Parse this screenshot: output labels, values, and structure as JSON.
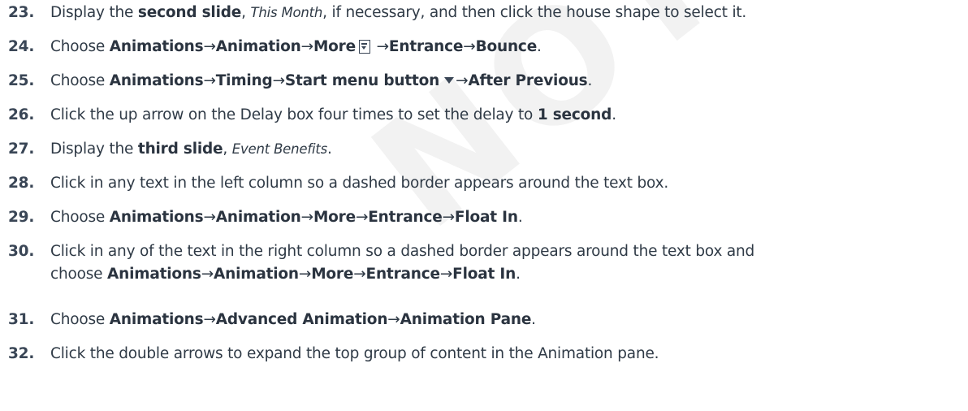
{
  "watermark": "NOT FOR SALE OR DISTRIBUTION ONLY",
  "steps": [
    {
      "num": "23.",
      "parts": [
        {
          "t": "Display the "
        },
        {
          "t": "second slide",
          "s": "b"
        },
        {
          "t": ", "
        },
        {
          "t": "This Month",
          "s": "i"
        },
        {
          "t": ", if necessary, and then click the house shape to select it."
        }
      ]
    },
    {
      "num": "24.",
      "parts": [
        {
          "t": "Choose "
        },
        {
          "t": "Animations",
          "s": "b"
        },
        {
          "t": "→",
          "s": "arr"
        },
        {
          "t": "Animation",
          "s": "b"
        },
        {
          "t": "→",
          "s": "arr"
        },
        {
          "t": "More",
          "s": "b"
        },
        {
          "icon": "more-dropdown-icon"
        },
        {
          "t": " →",
          "s": "arr"
        },
        {
          "t": "Entrance",
          "s": "b"
        },
        {
          "t": "→",
          "s": "arr"
        },
        {
          "t": "Bounce",
          "s": "b"
        },
        {
          "t": "."
        }
      ]
    },
    {
      "num": "25.",
      "parts": [
        {
          "t": "Choose "
        },
        {
          "t": "Animations",
          "s": "b"
        },
        {
          "t": "→",
          "s": "arr"
        },
        {
          "t": "Timing",
          "s": "b"
        },
        {
          "t": "→",
          "s": "arr"
        },
        {
          "t": "Start menu button",
          "s": "b"
        },
        {
          "icon": "dropdown-arrow-icon"
        },
        {
          "t": "→",
          "s": "arr"
        },
        {
          "t": "After Previous",
          "s": "b"
        },
        {
          "t": "."
        }
      ]
    },
    {
      "num": "26.",
      "parts": [
        {
          "t": "Click the up arrow on the Delay box four times to set the delay to "
        },
        {
          "t": "1 second",
          "s": "b"
        },
        {
          "t": "."
        }
      ]
    },
    {
      "num": "27.",
      "parts": [
        {
          "t": "Display the "
        },
        {
          "t": "third slide",
          "s": "b"
        },
        {
          "t": ", "
        },
        {
          "t": "Event Benefits",
          "s": "i"
        },
        {
          "t": "."
        }
      ]
    },
    {
      "num": "28.",
      "parts": [
        {
          "t": "Click in any text in the left column so a dashed border appears around the text box."
        }
      ]
    },
    {
      "num": "29.",
      "parts": [
        {
          "t": "Choose "
        },
        {
          "t": "Animations",
          "s": "b"
        },
        {
          "t": "→",
          "s": "arr"
        },
        {
          "t": "Animation",
          "s": "b"
        },
        {
          "t": "→",
          "s": "arr"
        },
        {
          "t": "More",
          "s": "b"
        },
        {
          "t": "→",
          "s": "arr"
        },
        {
          "t": "Entrance",
          "s": "b"
        },
        {
          "t": "→",
          "s": "arr"
        },
        {
          "t": "Float In",
          "s": "b"
        },
        {
          "t": "."
        }
      ]
    },
    {
      "num": "30.",
      "parts": [
        {
          "t": "Click in any of the text in the right column so a dashed border appears around the text box and"
        },
        {
          "br": true
        },
        {
          "t": "choose "
        },
        {
          "t": "Animations",
          "s": "b"
        },
        {
          "t": "→",
          "s": "arr"
        },
        {
          "t": "Animation",
          "s": "b"
        },
        {
          "t": "→",
          "s": "arr"
        },
        {
          "t": "More",
          "s": "b"
        },
        {
          "t": "→",
          "s": "arr"
        },
        {
          "t": "Entrance",
          "s": "b"
        },
        {
          "t": "→",
          "s": "arr"
        },
        {
          "t": "Float In",
          "s": "b"
        },
        {
          "t": "."
        }
      ]
    },
    {
      "num": "31.",
      "parts": [
        {
          "t": "Choose "
        },
        {
          "t": "Animations",
          "s": "b"
        },
        {
          "t": "→",
          "s": "arr"
        },
        {
          "t": "Advanced Animation",
          "s": "b"
        },
        {
          "t": "→",
          "s": "arr"
        },
        {
          "t": "Animation Pane",
          "s": "b"
        },
        {
          "t": "."
        }
      ]
    },
    {
      "num": "32.",
      "parts": [
        {
          "t": "Click the double arrows to expand the top group of content in the Animation pane."
        }
      ]
    }
  ]
}
